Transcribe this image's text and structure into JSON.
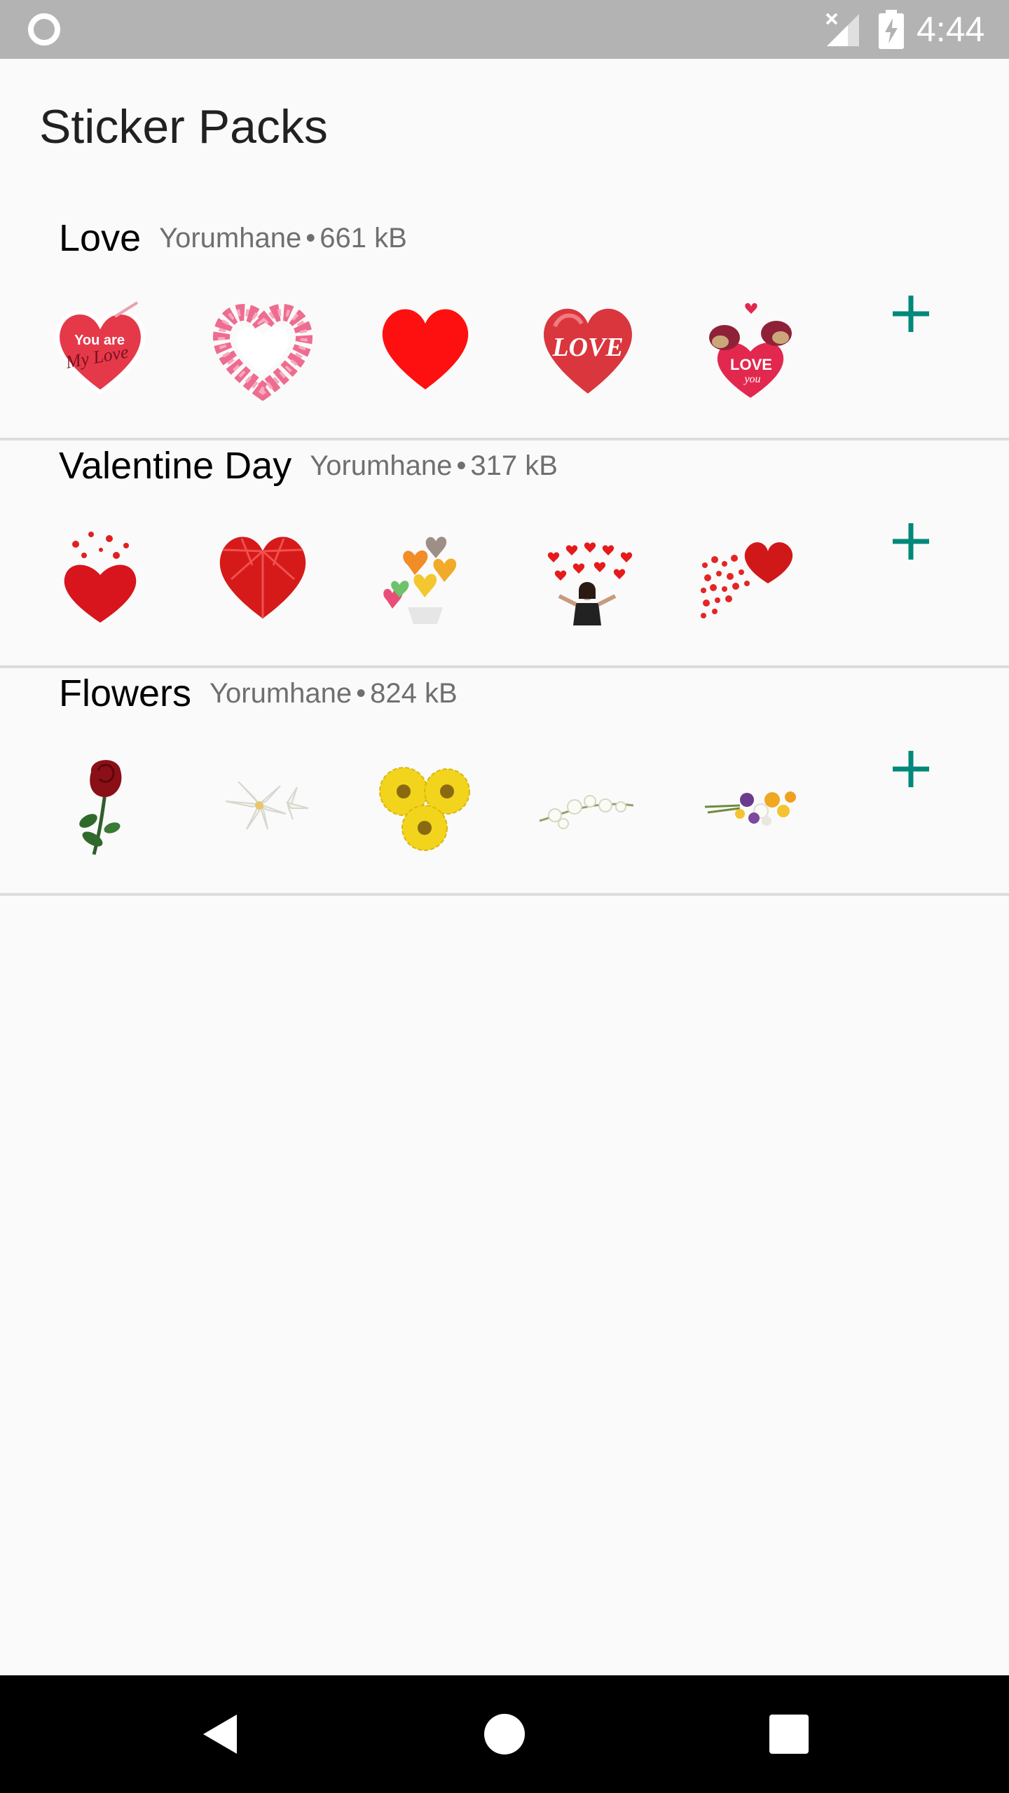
{
  "status_bar": {
    "time": "4:44",
    "icons": [
      "circle-notification-icon",
      "no-signal-icon",
      "battery-charging-icon"
    ]
  },
  "header": {
    "title": "Sticker Packs"
  },
  "packs": [
    {
      "name": "Love",
      "publisher": "Yorumhane",
      "size": "661 kB",
      "stickers": [
        "heart-you-are-my-love",
        "heart-wreath",
        "red-heart",
        "love-heart",
        "birds-love-you-heart"
      ],
      "sticker_texts": {
        "s1_line1": "You are",
        "s1_line2": "My Love",
        "s4": "LOVE",
        "s5_line1": "LOVE",
        "s5_line2": "you"
      }
    },
    {
      "name": "Valentine Day",
      "publisher": "Yorumhane",
      "size": "317 kB",
      "stickers": [
        "petal-heart",
        "ruby-heart",
        "candy-hearts",
        "girl-with-hearts",
        "scattered-hearts"
      ]
    },
    {
      "name": "Flowers",
      "publisher": "Yorumhane",
      "size": "824 kB",
      "stickers": [
        "red-rose",
        "white-lilies",
        "yellow-gerberas",
        "white-orchid-branch",
        "wildflower-bouquet"
      ]
    }
  ],
  "colors": {
    "accent": "#00897b",
    "status_bar": "#b3b3b3",
    "nav_bar": "#000000",
    "background": "#fafafa"
  }
}
